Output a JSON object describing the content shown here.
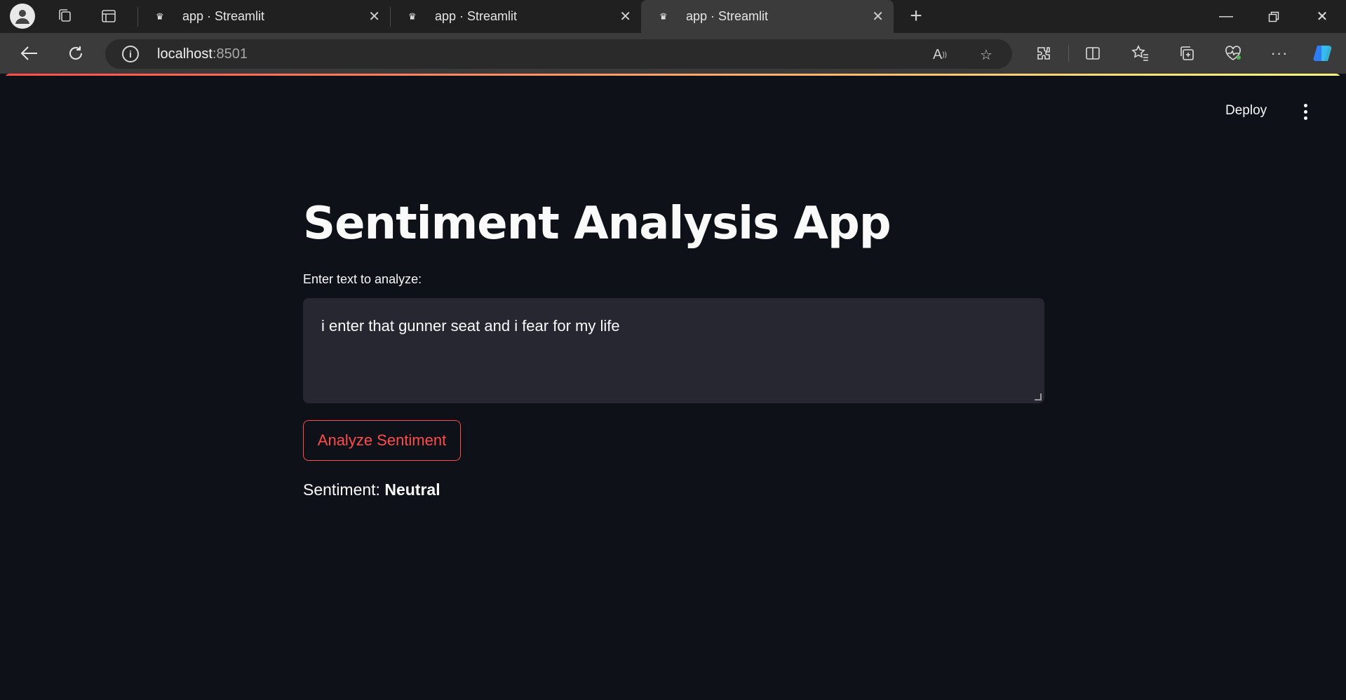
{
  "browser": {
    "tabs": [
      {
        "title": "app · Streamlit",
        "active": false
      },
      {
        "title": "app · Streamlit",
        "active": false
      },
      {
        "title": "app · Streamlit",
        "active": true
      }
    ],
    "url_host": "localhost",
    "url_port": ":8501"
  },
  "app": {
    "header": {
      "deploy_label": "Deploy"
    },
    "title": "Sentiment Analysis App",
    "input_label": "Enter text to analyze:",
    "input_value": "i enter that gunner seat and i fear for my life",
    "button_label": "Analyze Sentiment",
    "result_prefix": "Sentiment: ",
    "result_value": "Neutral"
  },
  "colors": {
    "background": "#0e1117",
    "accent": "#ff4b4b",
    "input_bg": "#262730"
  }
}
